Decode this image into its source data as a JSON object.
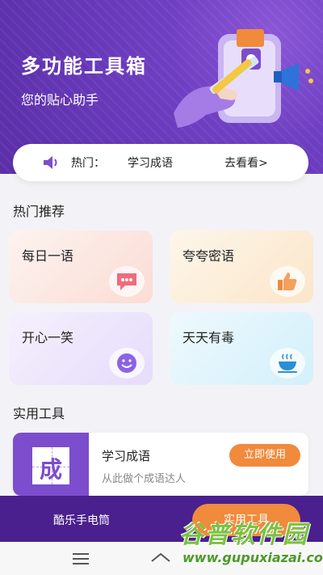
{
  "header": {
    "title": "多功能工具箱",
    "subtitle": "您的贴心助手"
  },
  "hot_bar": {
    "prefix": "热门：",
    "topic": "学习成语",
    "more": "去看看>"
  },
  "hot_section": {
    "title": "热门推荐",
    "cards": [
      {
        "label": "每日一语",
        "icon": "chat-bubble-icon"
      },
      {
        "label": "夸夸密语",
        "icon": "thumbs-up-icon"
      },
      {
        "label": "开心一笑",
        "icon": "smiley-icon"
      },
      {
        "label": "天天有毒",
        "icon": "hot-drink-icon"
      }
    ]
  },
  "tools_section": {
    "title": "实用工具",
    "items": [
      {
        "thumb_char": "成",
        "name": "学习成语",
        "desc": "从此做个成语达人",
        "button": "立即使用"
      }
    ]
  },
  "bottom_tabs": {
    "flashlight": "酷乐手电筒",
    "tools": "实用工具"
  },
  "watermark": {
    "name": "谷普软件园",
    "url": "www.gupuxiazai.com"
  },
  "colors": {
    "hero": "#6f3fc3",
    "accent": "#f08a3c",
    "tab_bar": "#4a1f8e"
  }
}
